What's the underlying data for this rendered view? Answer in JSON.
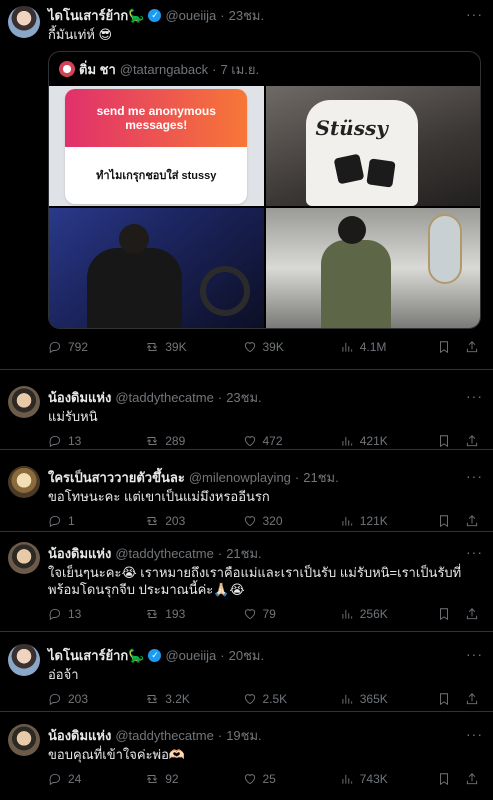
{
  "tweets": [
    {
      "name": "ไดโนเสาร์ย้าก🦕",
      "verified": true,
      "handle": "@oueiija",
      "time": "23ชม.",
      "text": "กี้มันเท่ห์ 😎",
      "quote": {
        "name": "ติ่ม ชา",
        "handle": "@tatarngaback",
        "time": "7 เม.ย.",
        "card_title": "send me anonymous messages!",
        "card_question": "ทำไมเกรุกชอบใส่ stussy",
        "shirt_logo": "Stüssy"
      },
      "replies": "792",
      "retweets": "39K",
      "likes": "39K",
      "views": "4.1M"
    },
    {
      "name": "น้องดิมแห่ง",
      "handle": "@taddythecatme",
      "time": "23ชม.",
      "text": "แม่รับหนิ",
      "replies": "13",
      "retweets": "289",
      "likes": "472",
      "views": "421K"
    },
    {
      "name": "ใครเป็นสาววายตัวขึ้นละ",
      "handle": "@milenowplaying",
      "time": "21ชม.",
      "text": "ขอโทษนะคะ แต่เขาเป็นแม่มึงหรออีนรก",
      "replies": "1",
      "retweets": "203",
      "likes": "320",
      "views": "121K"
    },
    {
      "name": "น้องดิมแห่ง",
      "handle": "@taddythecatme",
      "time": "21ชม.",
      "text": "ใจเย็นๆนะคะ😭 เราหมายถึงเราคือแม่และเราเป็นรับ แม่รับหนิ=เราเป็นรับที่พร้อมโดนรุกจีบ ประมาณนี้ค่ะ🙏🏻😭",
      "replies": "13",
      "retweets": "193",
      "likes": "79",
      "views": "256K"
    },
    {
      "name": "ไดโนเสาร์ย้าก🦕",
      "verified": true,
      "handle": "@oueiija",
      "time": "20ชม.",
      "text": "อ่อจ้า",
      "replies": "203",
      "retweets": "3.2K",
      "likes": "2.5K",
      "views": "365K"
    },
    {
      "name": "น้องดิมแห่ง",
      "handle": "@taddythecatme",
      "time": "19ชม.",
      "text": "ขอบคุณที่เข้าใจค่ะพ่อ🫶🏻",
      "replies": "24",
      "retweets": "92",
      "likes": "25",
      "views": "743K"
    }
  ],
  "ui": {
    "dot": "·",
    "more": "···",
    "verified_mark": "✓"
  }
}
